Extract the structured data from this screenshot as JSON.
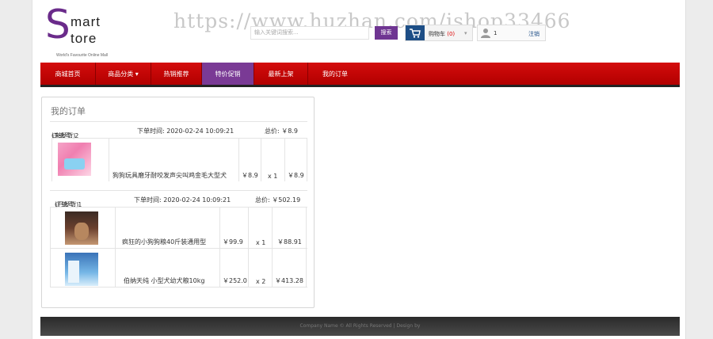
{
  "header": {
    "logo": {
      "s": "S",
      "mart": "mart",
      "tore": "tore",
      "tagline": "World's Favourite Online Mall"
    },
    "watermark": "https://www.huzhan.com/ishop33466",
    "search": {
      "placeholder": "输入关键词搜索...",
      "button": "搜索"
    },
    "cart": {
      "label": "购物车",
      "count": "(0)"
    },
    "user": {
      "name": "1",
      "logout": "注销"
    }
  },
  "nav": {
    "items": [
      {
        "label": "商城首页"
      },
      {
        "label": "商品分类 ▾"
      },
      {
        "label": "热销推荐"
      },
      {
        "label": "特价促销"
      },
      {
        "label": "最新上架"
      },
      {
        "label": "我的订单"
      }
    ]
  },
  "orders": {
    "title": "我的订单",
    "list": [
      {
        "order_no_label": "订单号: 2",
        "status": "(未发货)",
        "time": "下单时间: 2020-02-24 10:09:21",
        "total": "总价: ￥8.9",
        "items": [
          {
            "name": "狗狗玩具磨牙耐咬发声尖叫鸡金毛大型犬",
            "price": "￥8.9",
            "qty": "x 1",
            "subtotal": "￥8.9"
          }
        ]
      },
      {
        "order_no_label": "订单号: 1",
        "status": "(已发货)",
        "time": "下单时间: 2020-02-24 10:09:21",
        "total": "总价: ￥502.19",
        "items": [
          {
            "name": "疯狂的小狗狗粮40斤装通用型",
            "price": "￥99.9",
            "qty": "x 1",
            "subtotal": "￥88.91"
          },
          {
            "name": "伯纳天纯 小型犬幼犬粮10kg",
            "price": "￥252.0",
            "qty": "x 2",
            "subtotal": "￥413.28"
          }
        ]
      }
    ]
  },
  "footer": {
    "text": "Company Name © All Rights Reserved | Design by"
  }
}
